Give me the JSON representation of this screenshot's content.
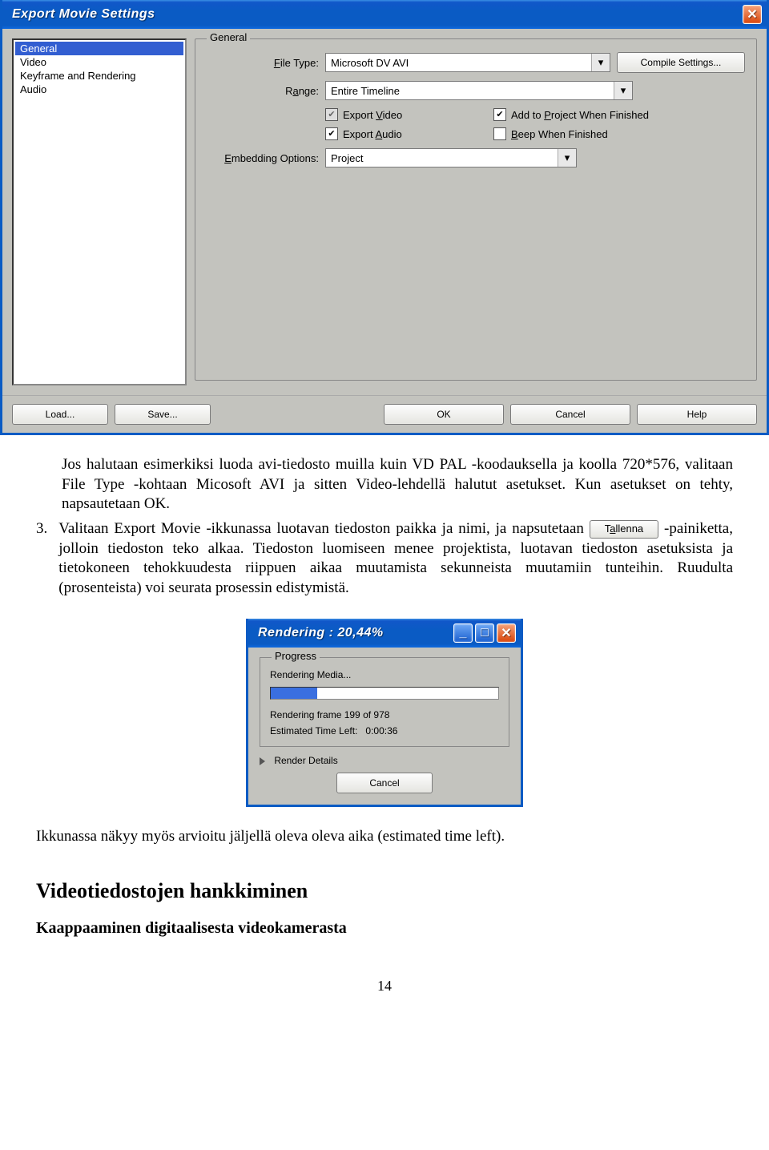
{
  "export_dialog": {
    "title": "Export Movie Settings",
    "list": {
      "items": [
        "General",
        "Video",
        "Keyframe and Rendering",
        "Audio"
      ],
      "selected_index": 0
    },
    "general": {
      "legend": "General",
      "file_type_label": "File Type:",
      "file_type_value": "Microsoft DV AVI",
      "compile_btn": "Compile Settings...",
      "range_label": "Range:",
      "range_value": "Entire Timeline",
      "cb_export_video": "Export Video",
      "cb_add_project": "Add to Project When Finished",
      "cb_export_audio": "Export Audio",
      "cb_beep": "Beep When Finished",
      "embedding_label": "Embedding Options:",
      "embedding_value": "Project"
    },
    "footer": {
      "load": "Load...",
      "save": "Save...",
      "ok": "OK",
      "cancel": "Cancel",
      "help": "Help"
    }
  },
  "body": {
    "para1": "Jos halutaan esimerkiksi luoda avi-tiedosto muilla kuin VD PAL -koodauksella ja koolla 720*576, valitaan File Type -kohtaan Micosoft AVI ja sitten Video-lehdellä halutut asetukset. Kun asetukset on tehty, napsautetaan OK.",
    "num3": "3.",
    "para3a": "Valitaan Export Movie -ikkunassa luotavan tiedoston paikka ja nimi, ja napsutetaan ",
    "tallenna": "Tallenna",
    "para3b": "-painiketta, jolloin tiedoston teko alkaa. Tiedoston luomiseen menee projektista, luotavan tiedoston asetuksista ja tietokoneen tehokkuudesta riippuen aikaa muutamista sekunneista muutamiin tunteihin. Ruudulta (prosenteista) voi seurata prosessin edistymistä.",
    "after_render": "Ikkunassa näkyy myös arvioitu jäljellä oleva oleva aika (estimated time left).",
    "heading": "Videotiedostojen hankkiminen",
    "subheading": "Kaappaaminen digitaalisesta videokamerasta",
    "pagenum": "14"
  },
  "render_dialog": {
    "title": "Rendering : 20,44%",
    "legend": "Progress",
    "status": "Rendering Media...",
    "progress_percent": 20.44,
    "frame_text": "Rendering frame 199 of 978",
    "eta_label": "Estimated Time Left:",
    "eta_value": "0:00:36",
    "details": "Render Details",
    "cancel": "Cancel"
  }
}
